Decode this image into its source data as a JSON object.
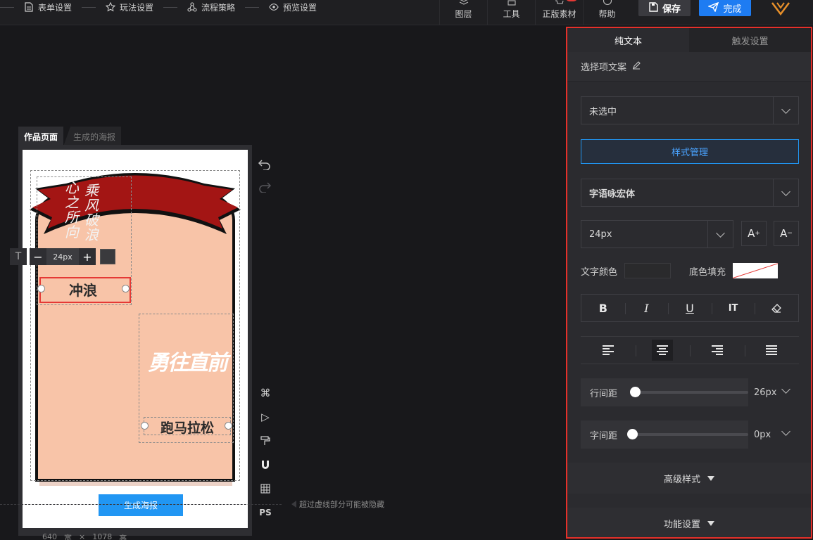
{
  "steps": [
    {
      "label": "表单设置",
      "icon": "document-icon"
    },
    {
      "label": "玩法设置",
      "icon": "star-icon"
    },
    {
      "label": "流程策略",
      "icon": "flow-icon"
    },
    {
      "label": "预览设置",
      "icon": "eye-icon"
    }
  ],
  "tools": [
    {
      "label": "图层",
      "icon": "layers-icon"
    },
    {
      "label": "工具",
      "icon": "toolbox-icon"
    },
    {
      "label": "正版素材",
      "icon": "cart-icon"
    },
    {
      "label": "帮助",
      "icon": "help-icon"
    }
  ],
  "actions": {
    "save": "保存",
    "done": "完成"
  },
  "page_tabs": {
    "active": "作品页面",
    "inactive": "生成的海报"
  },
  "poster": {
    "vertical_text": [
      "心之所向",
      "乘风破浪"
    ],
    "text_selected": "冲浪",
    "text_slogan": "勇往直前",
    "text_marathon": "跑马拉松",
    "generate_button": "生成海报",
    "colors": {
      "ribbon": "#a31514",
      "body": "#f8c4a8",
      "outline": "#111111"
    }
  },
  "float_toolbar": {
    "minus": "−",
    "value": "24px",
    "plus": "+",
    "text_icon": "T"
  },
  "side_tools": [
    "command-icon",
    "play-icon",
    "format-paint-icon",
    "magnet-icon",
    "grid-icon",
    "PS"
  ],
  "hint": "超过虚线部分可能被隐藏",
  "canvas_size": {
    "width": "640",
    "width_unit": "宽",
    "sep": "×",
    "height": "1078",
    "height_unit": "高"
  },
  "panel": {
    "tabs": {
      "active": "纯文本",
      "inactive": "触发设置"
    },
    "option_label": "选择项文案",
    "select_value": "未选中",
    "style_manage": "样式管理",
    "font_family": "字语咏宏体",
    "font_size": "24px",
    "text_color_label": "文字颜色",
    "bg_fill_label": "底色填充",
    "format_buttons": [
      "B",
      "I",
      "U",
      "IT",
      "eraser-icon"
    ],
    "align_buttons": [
      "align-left",
      "align-center",
      "align-right",
      "align-justify"
    ],
    "line_height_label": "行间距",
    "line_height_value": "26px",
    "letter_spacing_label": "字间距",
    "letter_spacing_value": "0px",
    "advanced_style": "高级样式",
    "function_settings": "功能设置"
  }
}
